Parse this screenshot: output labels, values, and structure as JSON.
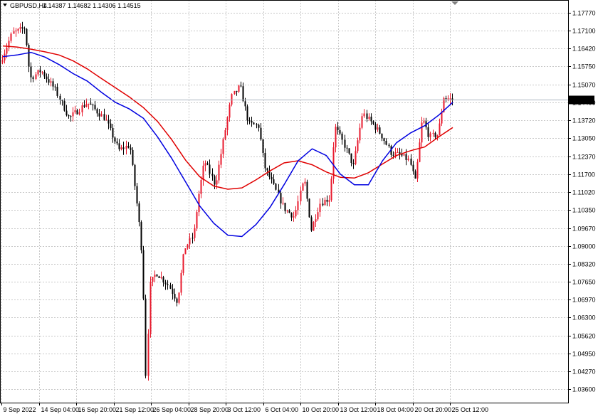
{
  "header": {
    "symbol": "GBPUSD,H4",
    "values": "1.14387 1.14682 1.14306 1.14515"
  },
  "colors": {
    "background": "#ffffff",
    "grid": "#c8c8c8",
    "axis": "#000000",
    "bull_candle": "#e8192c",
    "bear_candle": "#000000",
    "ma_fast": "#0000e0",
    "ma_slow": "#e00000",
    "current_price_line": "#a9b3bf",
    "current_price_box": "#000000"
  },
  "chart_data": {
    "type": "candlestick",
    "title": "GBPUSD,H4",
    "ohlc_header": "1.14387 1.14682 1.14306 1.14515",
    "current_price": "1.14515",
    "ylim": [
      1.031,
      1.1825
    ],
    "y_ticks": [
      "1.17770",
      "1.17100",
      "1.16420",
      "1.15750",
      "1.15070",
      "1.14400",
      "1.13720",
      "1.13050",
      "1.12370",
      "1.11700",
      "1.11020",
      "1.10350",
      "1.09670",
      "1.09000",
      "1.08320",
      "1.07650",
      "1.06970",
      "1.06300",
      "1.05620",
      "1.04950",
      "1.04270",
      "1.03600"
    ],
    "x_ticks": [
      "9 Sep 2022",
      "14 Sep 04:00",
      "16 Sep 20:00",
      "21 Sep 12:00",
      "26 Sep 04:00",
      "28 Sep 20:00",
      "3 Oct 12:00",
      "6 Oct 04:00",
      "10 Oct 20:00",
      "13 Oct 12:00",
      "18 Oct 04:00",
      "20 Oct 20:00",
      "25 Oct 12:00"
    ],
    "grid": true,
    "ma_fast_series": [
      1.1612,
      1.1618,
      1.1628,
      1.161,
      1.1582,
      1.1548,
      1.152,
      1.1478,
      1.144,
      1.1415,
      1.138,
      1.131,
      1.123,
      1.114,
      1.105,
      1.0985,
      1.094,
      1.0935,
      1.098,
      1.1045,
      1.113,
      1.122,
      1.1265,
      1.124,
      1.117,
      1.113,
      1.113,
      1.122,
      1.1288,
      1.1325,
      1.1352,
      1.1392,
      1.144
    ],
    "ma_slow_series": [
      1.1652,
      1.1648,
      1.164,
      1.163,
      1.1618,
      1.1596,
      1.1566,
      1.153,
      1.1495,
      1.146,
      1.142,
      1.1368,
      1.13,
      1.1222,
      1.116,
      1.1125,
      1.1113,
      1.1118,
      1.1148,
      1.1182,
      1.1212,
      1.122,
      1.1205,
      1.1178,
      1.1158,
      1.1155,
      1.1175,
      1.1208,
      1.124,
      1.1258,
      1.1272,
      1.131,
      1.1345
    ]
  }
}
